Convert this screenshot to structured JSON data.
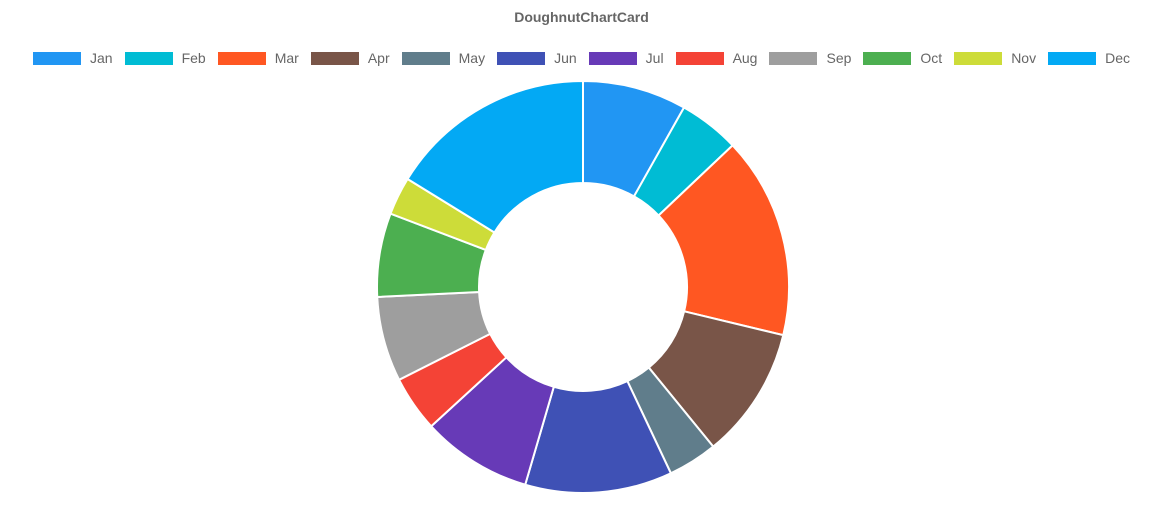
{
  "card": {
    "title": "DoughnutChartCard"
  },
  "chart_data": {
    "type": "doughnut",
    "title": "DoughnutChartCard",
    "legend_position": "top",
    "categories": [
      "Jan",
      "Feb",
      "Mar",
      "Apr",
      "May",
      "Jun",
      "Jul",
      "Aug",
      "Sep",
      "Oct",
      "Nov",
      "Dec"
    ],
    "values": [
      8.2,
      4.8,
      15.9,
      10.4,
      3.9,
      11.6,
      8.7,
      4.4,
      6.7,
      6.6,
      3.0,
      16.3
    ],
    "colors": [
      "#2196F3",
      "#00BCD4",
      "#FF5722",
      "#795548",
      "#607D8B",
      "#3F51B5",
      "#673AB7",
      "#F44336",
      "#9E9E9E",
      "#4CAF50",
      "#CDDC39",
      "#03A9F4"
    ]
  }
}
